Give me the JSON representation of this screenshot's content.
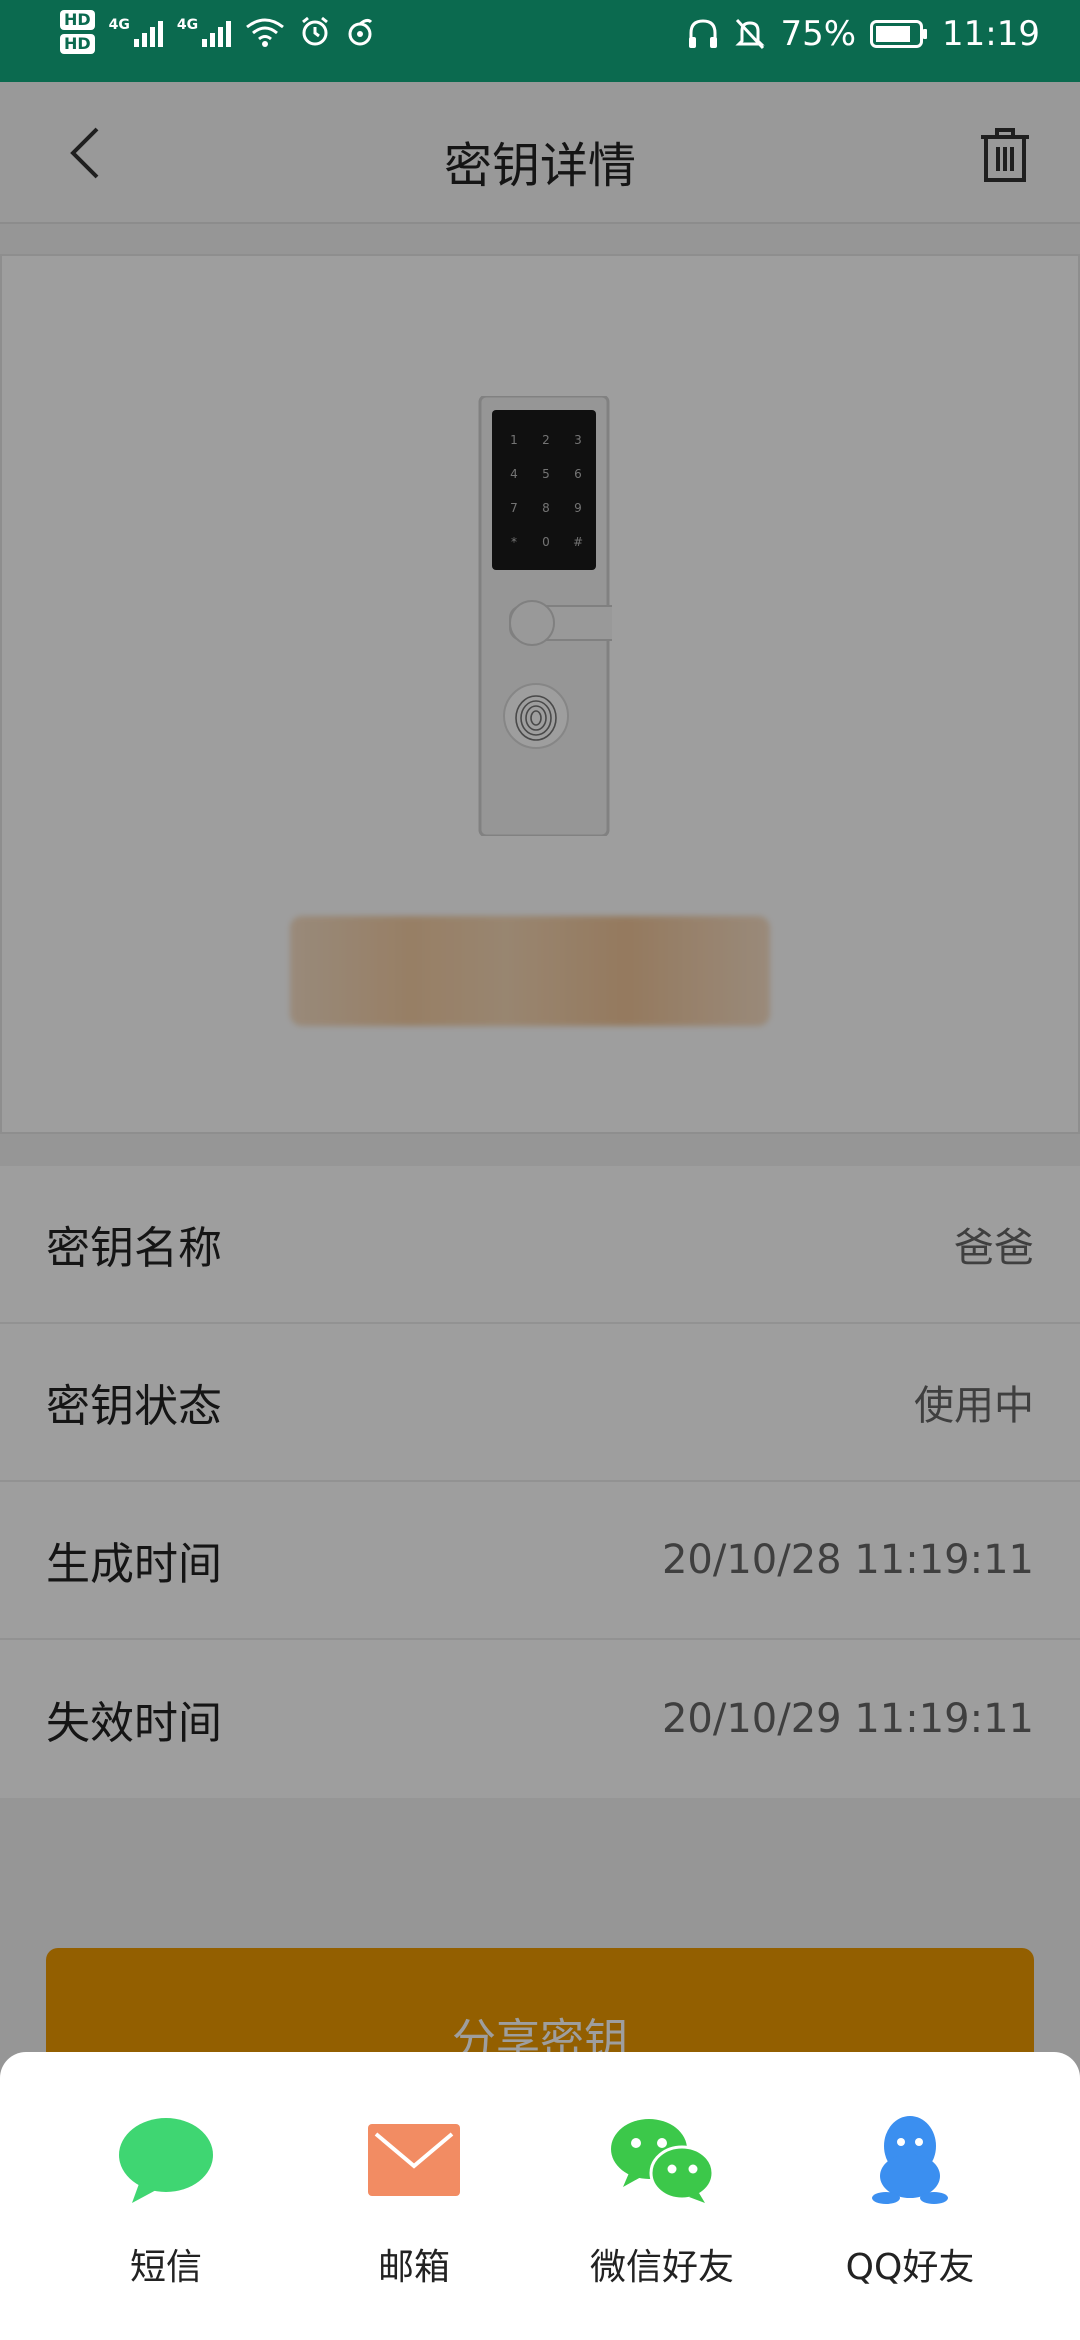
{
  "status_bar": {
    "hd1": "HD",
    "hd2": "HD",
    "net1": "4G",
    "net2": "4G",
    "battery": "75%",
    "time": "11:19"
  },
  "header": {
    "title": "密钥详情"
  },
  "details": [
    {
      "label": "密钥名称",
      "value": "爸爸"
    },
    {
      "label": "密钥状态",
      "value": "使用中"
    },
    {
      "label": "生成时间",
      "value": "20/10/28 11:19:11"
    },
    {
      "label": "失效时间",
      "value": "20/10/29 11:19:11"
    }
  ],
  "share_button_label": "分享密钥",
  "share_sheet": [
    {
      "label": "短信",
      "icon": "sms-icon",
      "color": "#3fd672"
    },
    {
      "label": "邮箱",
      "icon": "mail-icon",
      "color": "#f28c63"
    },
    {
      "label": "微信好友",
      "icon": "wechat-icon",
      "color": "#3cc84a"
    },
    {
      "label": "QQ好友",
      "icon": "qq-icon",
      "color": "#3b8ff0"
    }
  ],
  "lock_keypad": [
    "1",
    "2",
    "3",
    "4",
    "5",
    "6",
    "7",
    "8",
    "9",
    "*",
    "0",
    "#"
  ]
}
